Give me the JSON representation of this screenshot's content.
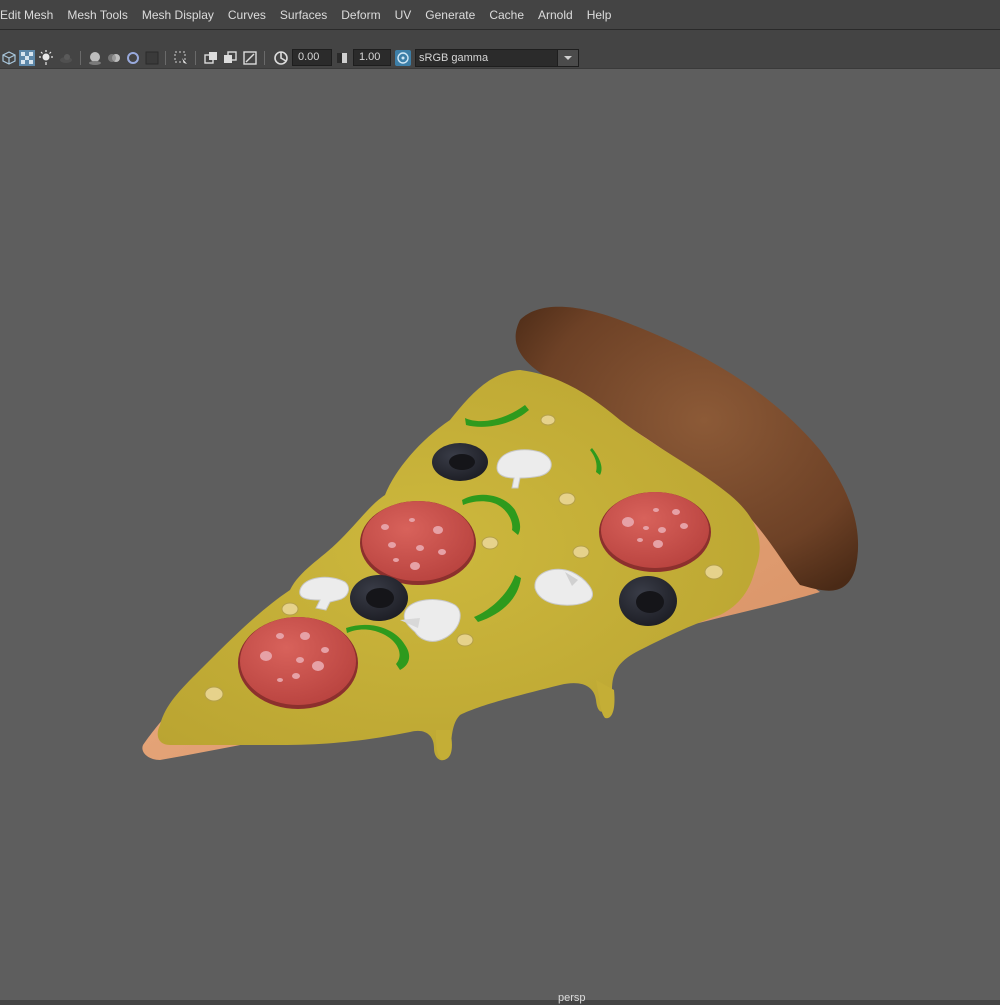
{
  "menu": [
    "Edit Mesh",
    "Mesh Tools",
    "Mesh Display",
    "Curves",
    "Surfaces",
    "Deform",
    "UV",
    "Generate",
    "Cache",
    "Arnold",
    "Help"
  ],
  "toolbar": {
    "exposure_value": "0.00",
    "gamma_value": "1.00",
    "color_space": "sRGB gamma",
    "icons": [
      "wireframe-cube-icon",
      "shaded-checker-icon",
      "light-bulb-icon",
      "shadow-icon",
      "ambient-occlusion-icon",
      "motion-blur-icon",
      "antialias-icon",
      "texture-icon",
      "isolate-select-icon",
      "xray-icon",
      "xray-joints-icon",
      "backface-icon",
      "exposure-icon",
      "gamma-icon",
      "color-management-icon",
      "dropdown-arrow-icon"
    ]
  },
  "viewport": {
    "camera_label": "persp"
  },
  "colors": {
    "background": "#5e5e5e",
    "cheese": "#c8b43b",
    "crust": "#7a4b2d",
    "pepperoni": "#c94f4b",
    "olive": "#2b2d36",
    "pepper": "#2e9a1d",
    "mushroom": "#eeeeee"
  }
}
